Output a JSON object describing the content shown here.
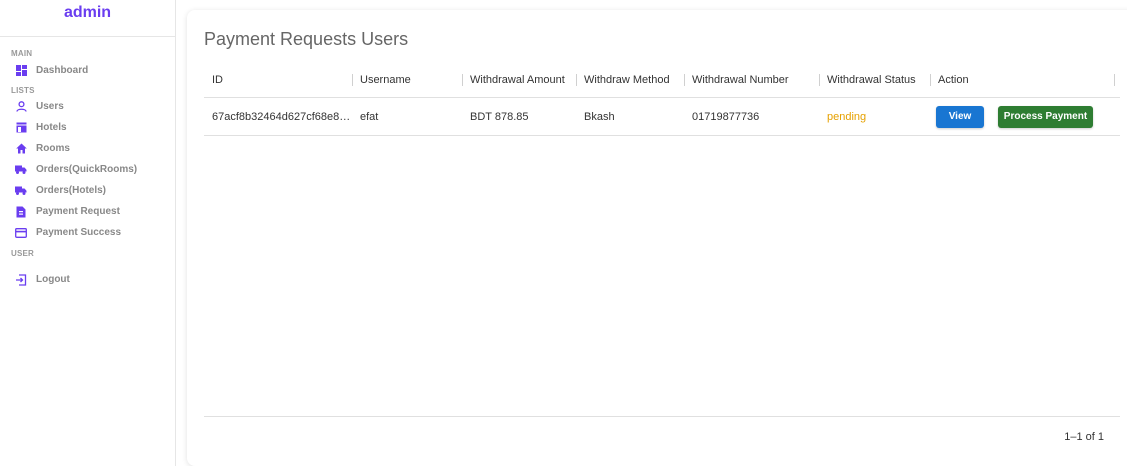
{
  "sidebar": {
    "logo": "admin",
    "sections": {
      "main": "MAIN",
      "lists": "LISTS",
      "user": "USER"
    },
    "items": {
      "dashboard": "Dashboard",
      "users": "Users",
      "hotels": "Hotels",
      "rooms": "Rooms",
      "orders_quickrooms": "Orders(QuickRooms)",
      "orders_hotels": "Orders(Hotels)",
      "payment_request": "Payment Request",
      "payment_success": "Payment Success",
      "logout": "Logout"
    },
    "icon_color": "#6a3df0"
  },
  "main": {
    "title": "Payment Requests Users",
    "columns": {
      "id": "ID",
      "username": "Username",
      "amount": "Withdrawal Amount",
      "method": "Withdraw Method",
      "number": "Withdrawal Number",
      "status": "Withdrawal Status",
      "action": "Action"
    },
    "rows": [
      {
        "id": "67acf8b32464d627cf68e8…",
        "username": "efat",
        "amount": "BDT 878.85",
        "method": "Bkash",
        "number": "01719877736",
        "status": "pending",
        "view_label": "View",
        "process_label": "Process Payment"
      }
    ],
    "pagination": "1–1 of 1"
  }
}
